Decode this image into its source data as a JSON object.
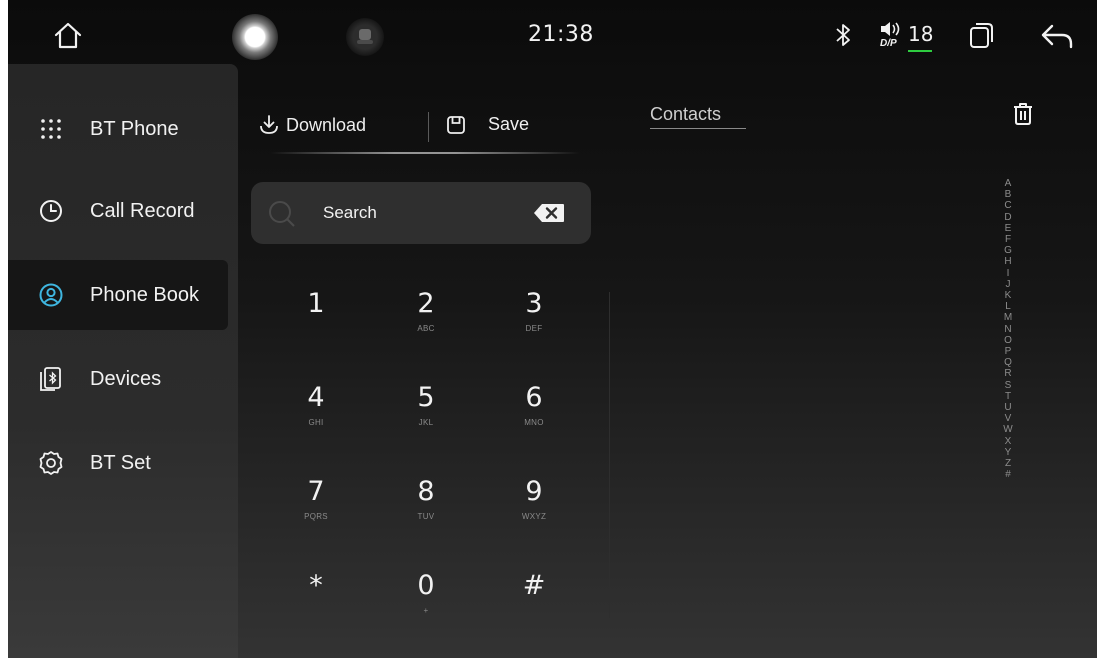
{
  "status_bar": {
    "time": "21:38",
    "volume_level": "18",
    "volume_mode": "D/P",
    "icons": [
      "home-icon",
      "siri-icon",
      "voice-assistant-icon",
      "bluetooth-icon",
      "speaker-icon",
      "window-switch-icon",
      "back-icon"
    ]
  },
  "sidebar": {
    "items": [
      {
        "label": "BT Phone",
        "icon": "dialpad-icon"
      },
      {
        "label": "Call Record",
        "icon": "clock-icon"
      },
      {
        "label": "Phone Book",
        "icon": "contact-icon",
        "active": true
      },
      {
        "label": "Devices",
        "icon": "bluetooth-device-icon"
      },
      {
        "label": "BT Set",
        "icon": "gear-icon"
      }
    ],
    "accent_color": "#3fb6e0"
  },
  "toolbar": {
    "download_label": "Download",
    "save_label": "Save"
  },
  "search": {
    "placeholder": "Search"
  },
  "keypad": {
    "keys": [
      {
        "digit": "1",
        "letters": ""
      },
      {
        "digit": "2",
        "letters": "ABC"
      },
      {
        "digit": "3",
        "letters": "DEF"
      },
      {
        "digit": "4",
        "letters": "GHI"
      },
      {
        "digit": "5",
        "letters": "JKL"
      },
      {
        "digit": "6",
        "letters": "MNO"
      },
      {
        "digit": "7",
        "letters": "PQRS"
      },
      {
        "digit": "8",
        "letters": "TUV"
      },
      {
        "digit": "9",
        "letters": "WXYZ"
      },
      {
        "digit": "*",
        "letters": ""
      },
      {
        "digit": "0",
        "letters": "+"
      },
      {
        "digit": "#",
        "letters": ""
      }
    ]
  },
  "contacts": {
    "tab_label": "Contacts",
    "alphabet_index": [
      "A",
      "B",
      "C",
      "D",
      "E",
      "F",
      "G",
      "H",
      "I",
      "J",
      "K",
      "L",
      "M",
      "N",
      "O",
      "P",
      "Q",
      "R",
      "S",
      "T",
      "U",
      "V",
      "W",
      "X",
      "Y",
      "Z",
      "#"
    ]
  }
}
